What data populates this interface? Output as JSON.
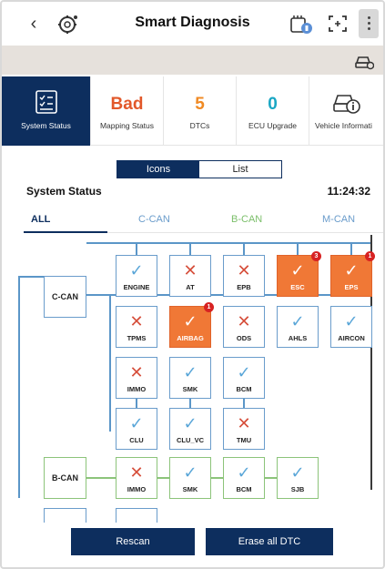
{
  "header": {
    "back_icon": "chevron-left-icon",
    "logo_icon": "diagnosis-gear-logo-icon",
    "title": "Smart Diagnosis",
    "icons": [
      "storage-card-icon",
      "screen-capture-icon",
      "more-vertical-icon"
    ]
  },
  "band": {
    "icon": "car-settings-icon"
  },
  "tiles": [
    {
      "label": "System Status",
      "icon": "checklist-icon",
      "active": true
    },
    {
      "value": "Bad",
      "label": "Mapping Status",
      "color": "#e2582a"
    },
    {
      "value": "5",
      "label": "DTCs",
      "color": "#f08a24"
    },
    {
      "value": "0",
      "label": "ECU Upgrade",
      "color": "#1aa7c4"
    },
    {
      "label": "Vehicle Informati",
      "icon": "car-info-icon"
    }
  ],
  "view_toggle": {
    "options": [
      "Icons",
      "List"
    ],
    "selected": "Icons"
  },
  "section": {
    "title": "System Status",
    "time": "11:24:32"
  },
  "tabs": [
    {
      "label": "ALL",
      "color": "#0d2e5e",
      "selected": true
    },
    {
      "label": "C-CAN",
      "color": "#6a9ccb",
      "selected": false
    },
    {
      "label": "B-CAN",
      "color": "#7bbf6a",
      "selected": false
    },
    {
      "label": "M-CAN",
      "color": "#6a9ccb",
      "selected": false
    }
  ],
  "buses": [
    {
      "label": "C-CAN",
      "color": "blue"
    },
    {
      "label": "B-CAN",
      "color": "green"
    }
  ],
  "nodes": [
    {
      "name": "ENGINE",
      "status": "ok",
      "bus": "blue"
    },
    {
      "name": "AT",
      "status": "fault",
      "bus": "blue"
    },
    {
      "name": "EPB",
      "status": "fault",
      "bus": "blue"
    },
    {
      "name": "ESC",
      "status": "alert",
      "bus": "blue",
      "badge": "3"
    },
    {
      "name": "EPS",
      "status": "alert",
      "bus": "blue",
      "badge": "1"
    },
    {
      "name": "TPMS",
      "status": "fault",
      "bus": "blue"
    },
    {
      "name": "AIRBAG",
      "status": "alert",
      "bus": "blue",
      "badge": "1"
    },
    {
      "name": "ODS",
      "status": "fault",
      "bus": "blue"
    },
    {
      "name": "AHLS",
      "status": "ok",
      "bus": "blue"
    },
    {
      "name": "AIRCON",
      "status": "ok",
      "bus": "blue"
    },
    {
      "name": "IMMO",
      "status": "fault",
      "bus": "blue"
    },
    {
      "name": "SMK",
      "status": "ok",
      "bus": "blue"
    },
    {
      "name": "BCM",
      "status": "ok",
      "bus": "blue"
    },
    {
      "name": "CLU",
      "status": "ok",
      "bus": "blue"
    },
    {
      "name": "CLU_VC",
      "status": "ok",
      "bus": "blue"
    },
    {
      "name": "TMU",
      "status": "fault",
      "bus": "blue"
    },
    {
      "name": "IMMO",
      "status": "fault",
      "bus": "green"
    },
    {
      "name": "SMK",
      "status": "ok",
      "bus": "green"
    },
    {
      "name": "BCM",
      "status": "ok",
      "bus": "green"
    },
    {
      "name": "SJB",
      "status": "ok",
      "bus": "green"
    }
  ],
  "buttons": {
    "rescan": "Rescan",
    "erase": "Erase all DTC"
  }
}
